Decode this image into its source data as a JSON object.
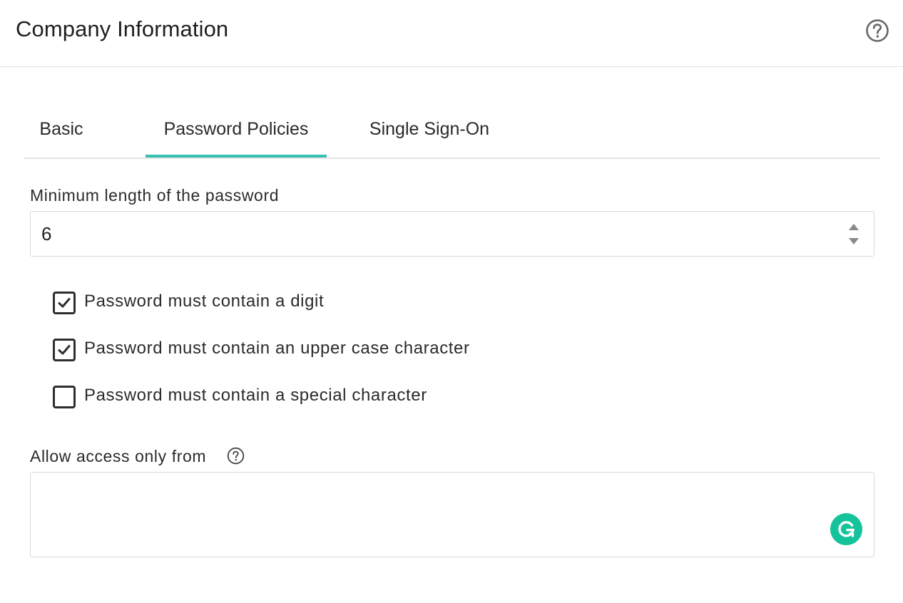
{
  "header": {
    "title": "Company Information",
    "help_icon": "question-circle-icon"
  },
  "tabs": [
    {
      "label": "Basic",
      "active": false
    },
    {
      "label": "Password Policies",
      "active": true
    },
    {
      "label": "Single Sign-On",
      "active": false
    }
  ],
  "accent_color": "#36c1b0",
  "password_policy": {
    "min_length_label": "Minimum length of the password",
    "min_length_value": "6",
    "checkboxes": [
      {
        "label": "Password must contain a digit",
        "checked": true
      },
      {
        "label": "Password must contain an upper case character",
        "checked": true
      },
      {
        "label": "Password must contain a special character",
        "checked": false
      }
    ]
  },
  "access": {
    "label": "Allow access only from",
    "value": "",
    "info_icon": "question-circle-icon"
  },
  "grammarly": {
    "icon": "grammarly-icon",
    "color": "#15c39a"
  }
}
